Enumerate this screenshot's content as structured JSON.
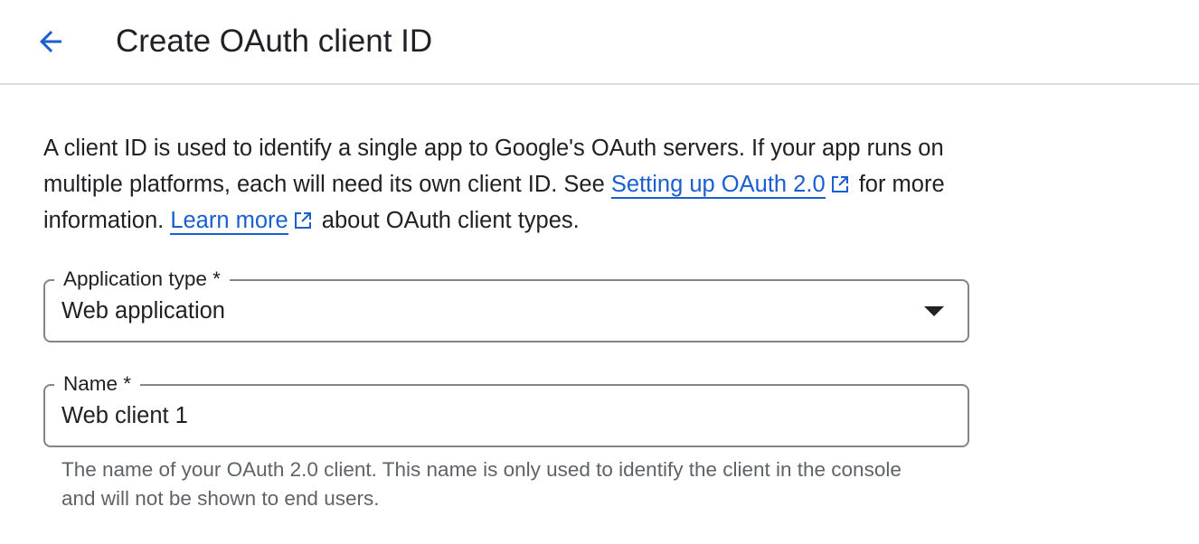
{
  "header": {
    "back_icon": "arrow-back-icon",
    "title": "Create OAuth client ID"
  },
  "intro": {
    "text_1": "A client ID is used to identify a single app to Google's OAuth servers. If your app runs on multiple platforms, each will need its own client ID. See ",
    "link_setup": "Setting up OAuth 2.0",
    "text_2": " for more information. ",
    "link_learn": "Learn more",
    "text_3": " about OAuth client types.",
    "external_icon": "open-in-new-icon"
  },
  "app_type": {
    "label": "Application type *",
    "value": "Web application"
  },
  "name_field": {
    "label": "Name *",
    "value": "Web client 1",
    "hint": "The name of your OAuth 2.0 client. This name is only used to identify the client in the console and will not be shown to end users."
  },
  "colors": {
    "accent": "#1a5fd0",
    "text": "#202124",
    "secondary_text": "#5f6368",
    "divider": "#dadce0",
    "field_border": "#80868b"
  }
}
